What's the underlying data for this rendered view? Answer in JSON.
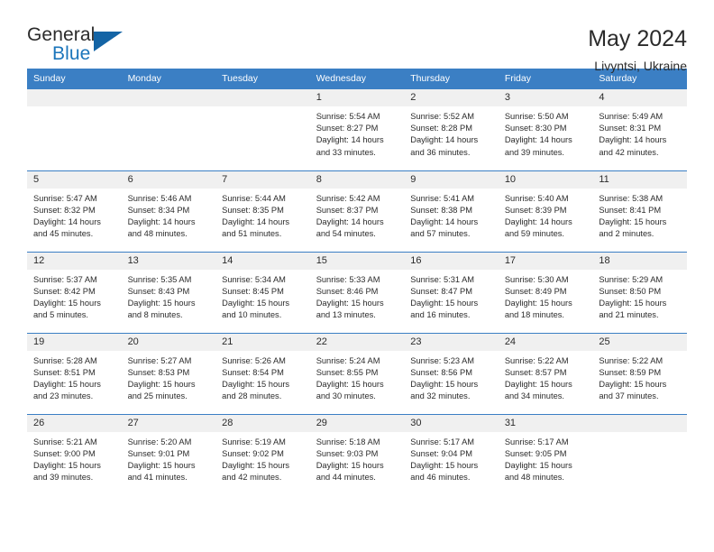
{
  "logo": {
    "word_one": "General",
    "word_two": "Blue",
    "triangle_color": "#1464a5",
    "blue_color": "#1b75bb"
  },
  "header": {
    "title": "May 2024",
    "subtitle": "Livyntsi, Ukraine",
    "accent_color": "#3b7fc4",
    "daynum_band_color": "#f0f0f0"
  },
  "weekday_headers": [
    "Sunday",
    "Monday",
    "Tuesday",
    "Wednesday",
    "Thursday",
    "Friday",
    "Saturday"
  ],
  "weeks": [
    [
      {
        "day": ""
      },
      {
        "day": ""
      },
      {
        "day": ""
      },
      {
        "day": "1",
        "sunrise": "Sunrise: 5:54 AM",
        "sunset": "Sunset: 8:27 PM",
        "daylight_line1": "Daylight: 14 hours",
        "daylight_line2": "and 33 minutes."
      },
      {
        "day": "2",
        "sunrise": "Sunrise: 5:52 AM",
        "sunset": "Sunset: 8:28 PM",
        "daylight_line1": "Daylight: 14 hours",
        "daylight_line2": "and 36 minutes."
      },
      {
        "day": "3",
        "sunrise": "Sunrise: 5:50 AM",
        "sunset": "Sunset: 8:30 PM",
        "daylight_line1": "Daylight: 14 hours",
        "daylight_line2": "and 39 minutes."
      },
      {
        "day": "4",
        "sunrise": "Sunrise: 5:49 AM",
        "sunset": "Sunset: 8:31 PM",
        "daylight_line1": "Daylight: 14 hours",
        "daylight_line2": "and 42 minutes."
      }
    ],
    [
      {
        "day": "5",
        "sunrise": "Sunrise: 5:47 AM",
        "sunset": "Sunset: 8:32 PM",
        "daylight_line1": "Daylight: 14 hours",
        "daylight_line2": "and 45 minutes."
      },
      {
        "day": "6",
        "sunrise": "Sunrise: 5:46 AM",
        "sunset": "Sunset: 8:34 PM",
        "daylight_line1": "Daylight: 14 hours",
        "daylight_line2": "and 48 minutes."
      },
      {
        "day": "7",
        "sunrise": "Sunrise: 5:44 AM",
        "sunset": "Sunset: 8:35 PM",
        "daylight_line1": "Daylight: 14 hours",
        "daylight_line2": "and 51 minutes."
      },
      {
        "day": "8",
        "sunrise": "Sunrise: 5:42 AM",
        "sunset": "Sunset: 8:37 PM",
        "daylight_line1": "Daylight: 14 hours",
        "daylight_line2": "and 54 minutes."
      },
      {
        "day": "9",
        "sunrise": "Sunrise: 5:41 AM",
        "sunset": "Sunset: 8:38 PM",
        "daylight_line1": "Daylight: 14 hours",
        "daylight_line2": "and 57 minutes."
      },
      {
        "day": "10",
        "sunrise": "Sunrise: 5:40 AM",
        "sunset": "Sunset: 8:39 PM",
        "daylight_line1": "Daylight: 14 hours",
        "daylight_line2": "and 59 minutes."
      },
      {
        "day": "11",
        "sunrise": "Sunrise: 5:38 AM",
        "sunset": "Sunset: 8:41 PM",
        "daylight_line1": "Daylight: 15 hours",
        "daylight_line2": "and 2 minutes."
      }
    ],
    [
      {
        "day": "12",
        "sunrise": "Sunrise: 5:37 AM",
        "sunset": "Sunset: 8:42 PM",
        "daylight_line1": "Daylight: 15 hours",
        "daylight_line2": "and 5 minutes."
      },
      {
        "day": "13",
        "sunrise": "Sunrise: 5:35 AM",
        "sunset": "Sunset: 8:43 PM",
        "daylight_line1": "Daylight: 15 hours",
        "daylight_line2": "and 8 minutes."
      },
      {
        "day": "14",
        "sunrise": "Sunrise: 5:34 AM",
        "sunset": "Sunset: 8:45 PM",
        "daylight_line1": "Daylight: 15 hours",
        "daylight_line2": "and 10 minutes."
      },
      {
        "day": "15",
        "sunrise": "Sunrise: 5:33 AM",
        "sunset": "Sunset: 8:46 PM",
        "daylight_line1": "Daylight: 15 hours",
        "daylight_line2": "and 13 minutes."
      },
      {
        "day": "16",
        "sunrise": "Sunrise: 5:31 AM",
        "sunset": "Sunset: 8:47 PM",
        "daylight_line1": "Daylight: 15 hours",
        "daylight_line2": "and 16 minutes."
      },
      {
        "day": "17",
        "sunrise": "Sunrise: 5:30 AM",
        "sunset": "Sunset: 8:49 PM",
        "daylight_line1": "Daylight: 15 hours",
        "daylight_line2": "and 18 minutes."
      },
      {
        "day": "18",
        "sunrise": "Sunrise: 5:29 AM",
        "sunset": "Sunset: 8:50 PM",
        "daylight_line1": "Daylight: 15 hours",
        "daylight_line2": "and 21 minutes."
      }
    ],
    [
      {
        "day": "19",
        "sunrise": "Sunrise: 5:28 AM",
        "sunset": "Sunset: 8:51 PM",
        "daylight_line1": "Daylight: 15 hours",
        "daylight_line2": "and 23 minutes."
      },
      {
        "day": "20",
        "sunrise": "Sunrise: 5:27 AM",
        "sunset": "Sunset: 8:53 PM",
        "daylight_line1": "Daylight: 15 hours",
        "daylight_line2": "and 25 minutes."
      },
      {
        "day": "21",
        "sunrise": "Sunrise: 5:26 AM",
        "sunset": "Sunset: 8:54 PM",
        "daylight_line1": "Daylight: 15 hours",
        "daylight_line2": "and 28 minutes."
      },
      {
        "day": "22",
        "sunrise": "Sunrise: 5:24 AM",
        "sunset": "Sunset: 8:55 PM",
        "daylight_line1": "Daylight: 15 hours",
        "daylight_line2": "and 30 minutes."
      },
      {
        "day": "23",
        "sunrise": "Sunrise: 5:23 AM",
        "sunset": "Sunset: 8:56 PM",
        "daylight_line1": "Daylight: 15 hours",
        "daylight_line2": "and 32 minutes."
      },
      {
        "day": "24",
        "sunrise": "Sunrise: 5:22 AM",
        "sunset": "Sunset: 8:57 PM",
        "daylight_line1": "Daylight: 15 hours",
        "daylight_line2": "and 34 minutes."
      },
      {
        "day": "25",
        "sunrise": "Sunrise: 5:22 AM",
        "sunset": "Sunset: 8:59 PM",
        "daylight_line1": "Daylight: 15 hours",
        "daylight_line2": "and 37 minutes."
      }
    ],
    [
      {
        "day": "26",
        "sunrise": "Sunrise: 5:21 AM",
        "sunset": "Sunset: 9:00 PM",
        "daylight_line1": "Daylight: 15 hours",
        "daylight_line2": "and 39 minutes."
      },
      {
        "day": "27",
        "sunrise": "Sunrise: 5:20 AM",
        "sunset": "Sunset: 9:01 PM",
        "daylight_line1": "Daylight: 15 hours",
        "daylight_line2": "and 41 minutes."
      },
      {
        "day": "28",
        "sunrise": "Sunrise: 5:19 AM",
        "sunset": "Sunset: 9:02 PM",
        "daylight_line1": "Daylight: 15 hours",
        "daylight_line2": "and 42 minutes."
      },
      {
        "day": "29",
        "sunrise": "Sunrise: 5:18 AM",
        "sunset": "Sunset: 9:03 PM",
        "daylight_line1": "Daylight: 15 hours",
        "daylight_line2": "and 44 minutes."
      },
      {
        "day": "30",
        "sunrise": "Sunrise: 5:17 AM",
        "sunset": "Sunset: 9:04 PM",
        "daylight_line1": "Daylight: 15 hours",
        "daylight_line2": "and 46 minutes."
      },
      {
        "day": "31",
        "sunrise": "Sunrise: 5:17 AM",
        "sunset": "Sunset: 9:05 PM",
        "daylight_line1": "Daylight: 15 hours",
        "daylight_line2": "and 48 minutes."
      },
      {
        "day": ""
      }
    ]
  ]
}
